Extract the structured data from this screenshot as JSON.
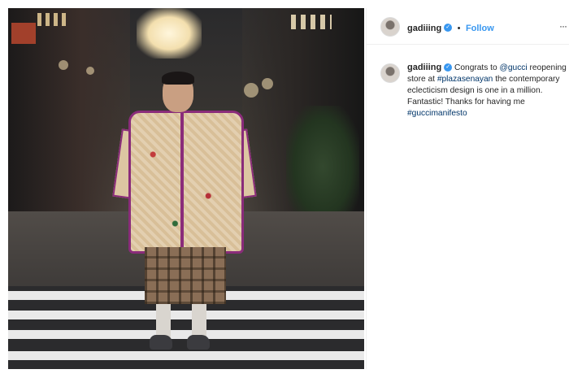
{
  "header": {
    "username": "gadiiing",
    "separator": "•",
    "follow_label": "Follow",
    "more_icon": "ellipsis-icon"
  },
  "post": {
    "image_alt": "Man in floral coat and plaid shorts standing on zebra crossing in mall"
  },
  "caption": {
    "username": "gadiiing",
    "parts": [
      "Congrats to ",
      "@gucci",
      " reopening store at ",
      "#plazasenayan",
      " the contemporary eclecticism design is one in a million. Fantastic! Thanks for having me ",
      "#guccimanifesto"
    ]
  },
  "colors": {
    "link": "#003569",
    "follow": "#3897f0",
    "verified": "#3897f0"
  }
}
